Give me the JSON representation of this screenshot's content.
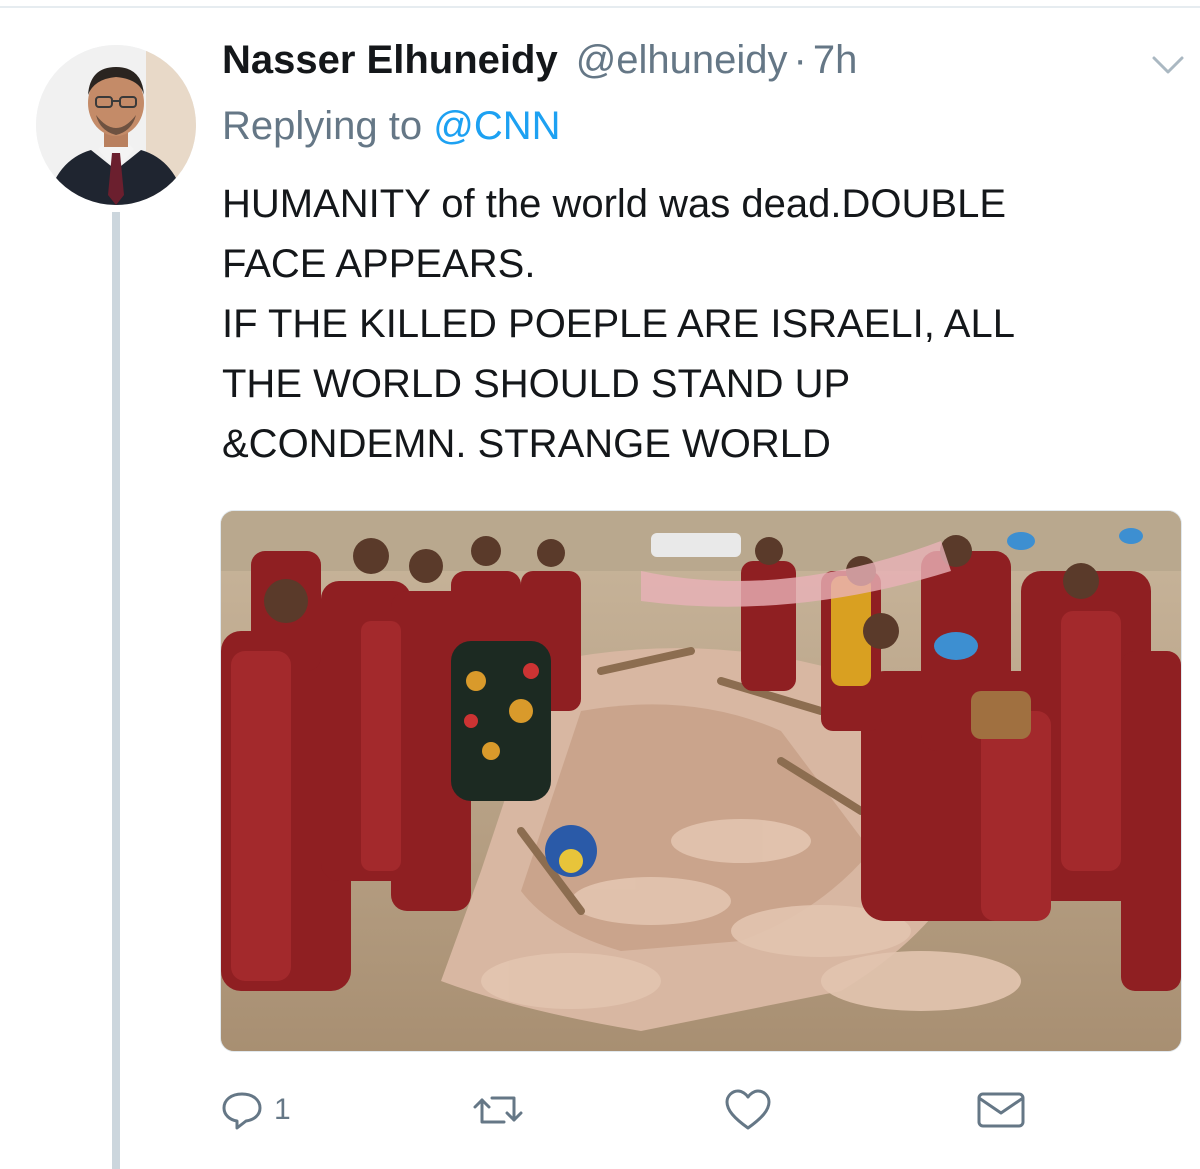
{
  "tweet": {
    "display_name": "Nasser Elhuneidy",
    "handle": "@elhuneidy",
    "separator": "·",
    "time": "7h",
    "replying_prefix": "Replying to",
    "replying_to": "@CNN",
    "text_lines": [
      "HUMANITY of the world was dead.DOUBLE",
      "FACE APPEARS.",
      "IF THE KILLED POEPLE ARE ISRAELI, ALL",
      "THE WORLD SHOULD STAND UP",
      "&CONDEMN. STRANGE WORLD"
    ]
  },
  "actions": {
    "reply_icon": "reply-icon",
    "reply_count": "1",
    "retweet_icon": "retweet-icon",
    "like_icon": "heart-icon",
    "dm_icon": "envelope-icon"
  },
  "colors": {
    "text": "#14171a",
    "muted": "#657786",
    "link": "#1da1f2",
    "divider": "#e6ecf0",
    "thread_line": "#ccd6dd"
  }
}
